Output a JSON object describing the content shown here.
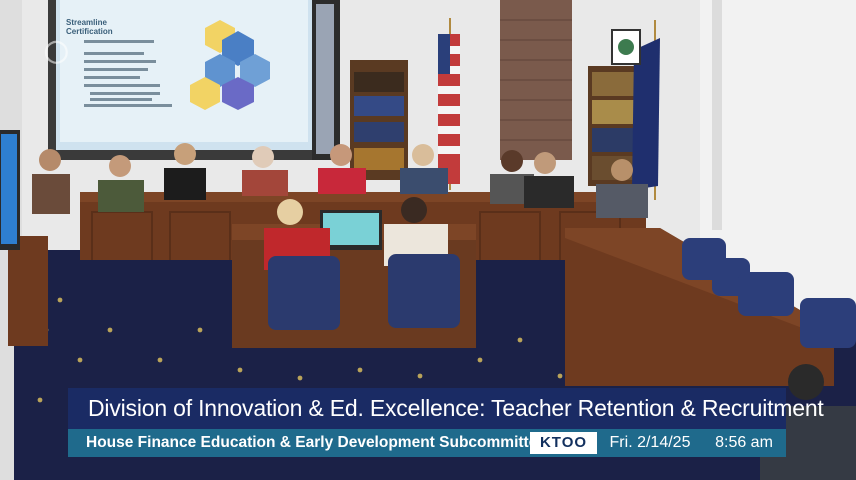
{
  "broadcast": {
    "title": "Division of Innovation & Ed. Excellence: Teacher Retention & Recruitment",
    "subtitle": "House Finance Education & Early Development Subcommittee",
    "brand": "KTOO",
    "date": "Fri. 2/14/25",
    "time": "8:56 am"
  },
  "projector": {
    "heading_line1": "Streamline",
    "heading_line2": "Certification"
  },
  "colors": {
    "banner_dark": "#1a2b64",
    "banner_teal": "#1f6a8c",
    "wood": "#6e3a1f",
    "carpet": "#1b2147"
  }
}
